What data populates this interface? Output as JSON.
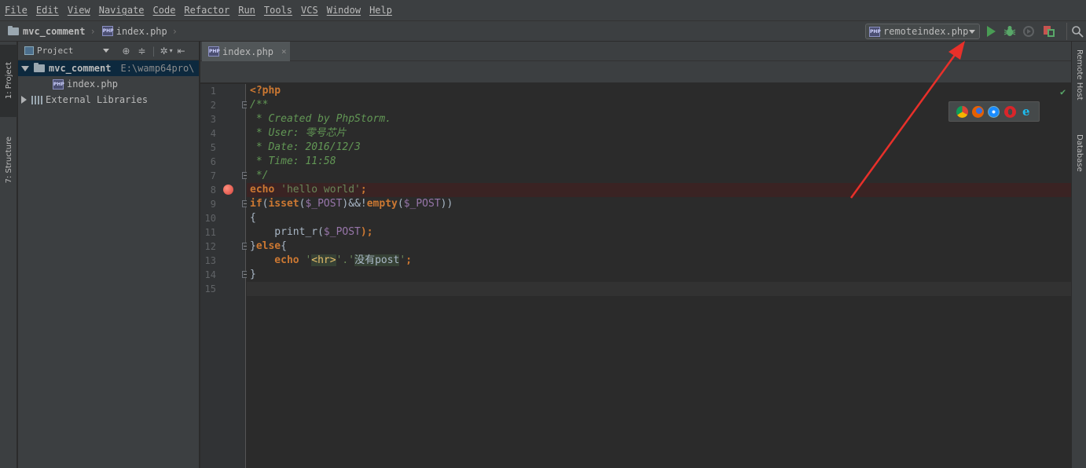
{
  "menu": [
    "File",
    "Edit",
    "View",
    "Navigate",
    "Code",
    "Refactor",
    "Run",
    "Tools",
    "VCS",
    "Window",
    "Help"
  ],
  "breadcrumb": {
    "project": "mvc_comment",
    "file": "index.php"
  },
  "run_config": {
    "label": "remoteindex.php"
  },
  "left_tabs": {
    "project": "1: Project",
    "structure": "7: Structure"
  },
  "project_panel": {
    "title": "Project",
    "root": {
      "name": "mvc_comment",
      "path": "E:\\wamp64pro\\"
    },
    "file": "index.php",
    "libs": "External Libraries"
  },
  "editor": {
    "tab": "index.php",
    "tab_close": "×",
    "line_numbers": [
      "1",
      "2",
      "3",
      "4",
      "5",
      "6",
      "7",
      "8",
      "9",
      "10",
      "11",
      "12",
      "13",
      "14",
      "15"
    ],
    "code": {
      "l1_open": "<?php",
      "l2": "/**",
      "l3": " * Created by PhpStorm.",
      "l4": " * User: 零号芯片",
      "l5": " * Date: 2016/12/3",
      "l6": " * Time: 11:58",
      "l7": " */",
      "l8_kw": "echo",
      "l8_str": "'hello world'",
      "l8_end": ";",
      "l9_if": "if",
      "l9_a": "(",
      "l9_isset": "isset",
      "l9_b": "(",
      "l9_var1": "$_POST",
      "l9_c": ")&&!",
      "l9_empty": "empty",
      "l9_d": "(",
      "l9_var2": "$_POST",
      "l9_e": "))",
      "l10": "{",
      "l11_fn": "    print_r(",
      "l11_var": "$_POST",
      "l11_end": ");",
      "l12_a": "}",
      "l12_else": "else",
      "l12_b": "{",
      "l13_kw": "    echo",
      "l13_q1": "'",
      "l13_lt": "<",
      "l13_hr": "hr",
      "l13_gt": ">",
      "l13_dot": "'.'",
      "l13_txt": "没有post",
      "l13_q2": "'",
      "l13_end": ";",
      "l14": "}"
    }
  },
  "right_tabs": {
    "remote": "Remote Host",
    "db": "Database"
  },
  "icons": [
    "run-icon",
    "debug-icon",
    "coverage-icon",
    "stop-icon",
    "search-icon",
    "chrome-icon",
    "firefox-icon",
    "safari-icon",
    "opera-icon",
    "ie-icon"
  ]
}
